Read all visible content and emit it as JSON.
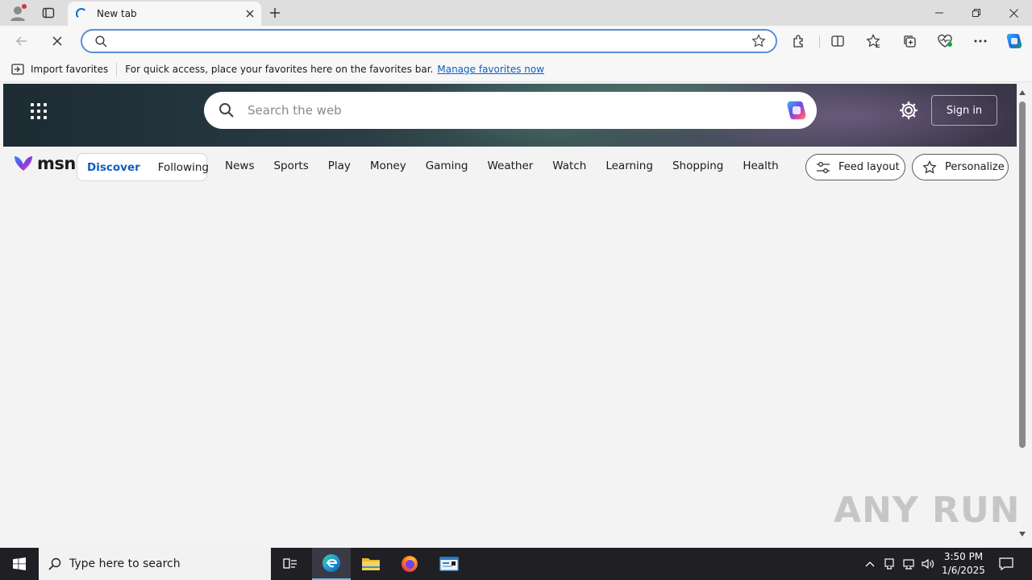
{
  "browser": {
    "tab_title": "New tab",
    "address_value": "",
    "favorites_bar": {
      "import_label": "Import favorites",
      "message": "For quick access, place your favorites here on the favorites bar.",
      "link_label": "Manage favorites now"
    }
  },
  "msn": {
    "search_placeholder": "Search the web",
    "sign_in_label": "Sign in",
    "logo_text": "msn",
    "pill": {
      "discover": "Discover",
      "following": "Following"
    },
    "categories": [
      "News",
      "Sports",
      "Play",
      "Money",
      "Gaming",
      "Weather",
      "Watch",
      "Learning",
      "Shopping",
      "Health"
    ],
    "feed_layout_label": "Feed layout",
    "personalize_label": "Personalize"
  },
  "watermark": "ANY RUN",
  "taskbar": {
    "search_placeholder": "Type here to search",
    "time": "3:50 PM",
    "date": "1/6/2025"
  },
  "colors": {
    "accent": "#0f5fc2",
    "address_border": "#5a8fd6",
    "taskbar": "#1f1f24"
  }
}
